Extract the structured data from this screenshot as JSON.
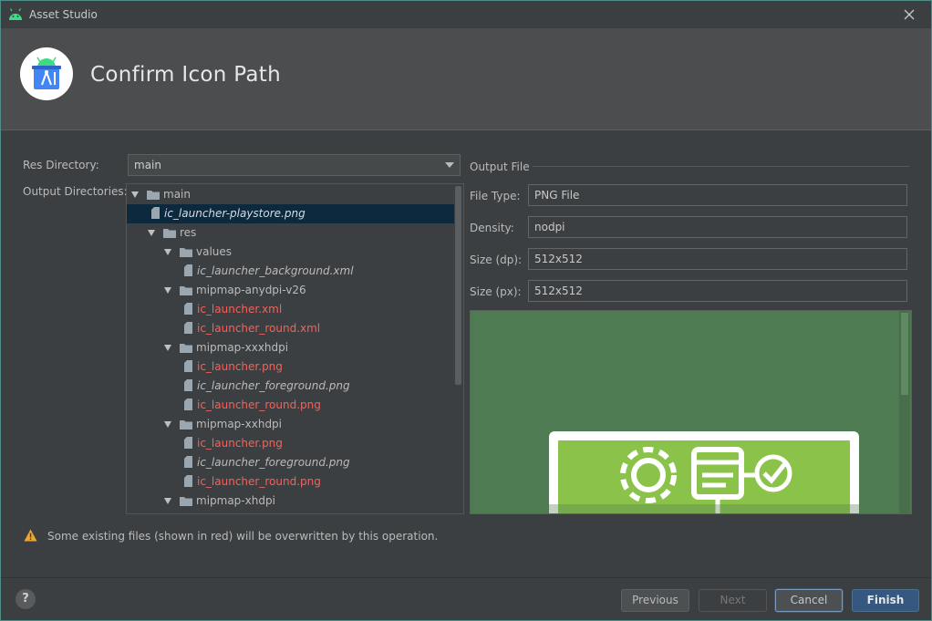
{
  "window": {
    "title": "Asset Studio"
  },
  "header": {
    "title": "Confirm Icon Path"
  },
  "form": {
    "res_directory_label": "Res Directory:",
    "res_directory_value": "main",
    "output_directories_label": "Output Directories:"
  },
  "tree": [
    {
      "text": "main",
      "type": "folder",
      "level": 0,
      "expanded": true,
      "status": "normal"
    },
    {
      "text": "ic_launcher-playstore.png",
      "type": "file",
      "level": 1,
      "status": "new",
      "selected": true
    },
    {
      "text": "res",
      "type": "folder",
      "level": 1,
      "expanded": true,
      "status": "normal"
    },
    {
      "text": "values",
      "type": "folder",
      "level": 2,
      "expanded": true,
      "status": "normal"
    },
    {
      "text": "ic_launcher_background.xml",
      "type": "file",
      "level": 3,
      "status": "new"
    },
    {
      "text": "mipmap-anydpi-v26",
      "type": "folder",
      "level": 2,
      "expanded": true,
      "status": "normal"
    },
    {
      "text": "ic_launcher.xml",
      "type": "file",
      "level": 3,
      "status": "overwrite"
    },
    {
      "text": "ic_launcher_round.xml",
      "type": "file",
      "level": 3,
      "status": "overwrite"
    },
    {
      "text": "mipmap-xxxhdpi",
      "type": "folder",
      "level": 2,
      "expanded": true,
      "status": "normal"
    },
    {
      "text": "ic_launcher.png",
      "type": "file",
      "level": 3,
      "status": "overwrite"
    },
    {
      "text": "ic_launcher_foreground.png",
      "type": "file",
      "level": 3,
      "status": "new"
    },
    {
      "text": "ic_launcher_round.png",
      "type": "file",
      "level": 3,
      "status": "overwrite"
    },
    {
      "text": "mipmap-xxhdpi",
      "type": "folder",
      "level": 2,
      "expanded": true,
      "status": "normal"
    },
    {
      "text": "ic_launcher.png",
      "type": "file",
      "level": 3,
      "status": "overwrite"
    },
    {
      "text": "ic_launcher_foreground.png",
      "type": "file",
      "level": 3,
      "status": "new"
    },
    {
      "text": "ic_launcher_round.png",
      "type": "file",
      "level": 3,
      "status": "overwrite"
    },
    {
      "text": "mipmap-xhdpi",
      "type": "folder",
      "level": 2,
      "expanded": true,
      "status": "normal"
    }
  ],
  "output_file": {
    "section_title": "Output File",
    "file_type_label": "File Type:",
    "file_type_value": "PNG File",
    "density_label": "Density:",
    "density_value": "nodpi",
    "size_dp_label": "Size (dp):",
    "size_dp_value": "512x512",
    "size_px_label": "Size (px):",
    "size_px_value": "512x512"
  },
  "warning": {
    "text": "Some existing files (shown in red) will be overwritten by this operation."
  },
  "footer": {
    "help_label": "?",
    "previous_label": "Previous",
    "next_label": "Next",
    "cancel_label": "Cancel",
    "finish_label": "Finish"
  },
  "colors": {
    "overwrite_text": "#f5615a",
    "selection": "#0d293e",
    "preview_background": "#4f7b52",
    "icon_green": "#8bc34a",
    "finish_button": "#365880",
    "warning": "#f0a732"
  }
}
